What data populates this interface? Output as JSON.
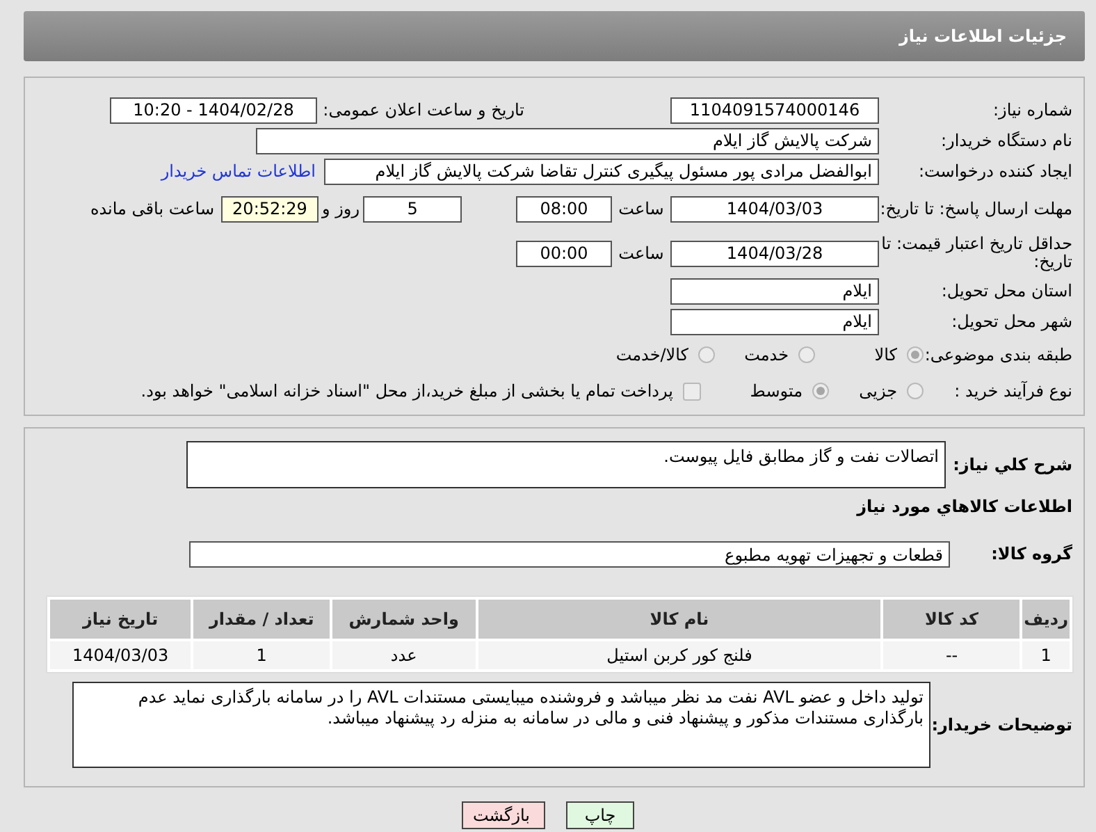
{
  "header": {
    "title": "جزئیات اطلاعات نیاز"
  },
  "details": {
    "need_number": {
      "label": "شماره نیاز:",
      "value": "1104091574000146"
    },
    "announce": {
      "label": "تاریخ و ساعت اعلان عمومی:",
      "value": "1404/02/28 - 10:20"
    },
    "buyer_org": {
      "label": "نام دستگاه خریدار:",
      "value": "شرکت پالایش گاز ایلام"
    },
    "requester": {
      "label": "ایجاد کننده درخواست:",
      "value": "ابوالفضل مرادی پور مسئول پیگیری کنترل تقاضا شرکت پالایش گاز ایلام",
      "link": "اطلاعات تماس خریدار"
    },
    "deadline": {
      "label": "مهلت ارسال پاسخ: تا تاریخ:",
      "date": "1404/03/03",
      "time_label": "ساعت",
      "time": "08:00",
      "days": "5",
      "days_label": "روز و",
      "remaining": "20:52:29",
      "remaining_label": "ساعت باقی مانده"
    },
    "price_validity": {
      "label": "حداقل تاریخ اعتبار قیمت: تا تاریخ:",
      "date": "1404/03/28",
      "time_label": "ساعت",
      "time": "00:00"
    },
    "province": {
      "label": "استان محل تحویل:",
      "value": "ایلام"
    },
    "city": {
      "label": "شهر محل تحویل:",
      "value": "ایلام"
    },
    "category": {
      "label": "طبقه بندی موضوعی:",
      "options": [
        {
          "label": "کالا",
          "selected": true
        },
        {
          "label": "خدمت",
          "selected": false
        },
        {
          "label": "کالا/خدمت",
          "selected": false
        }
      ]
    },
    "process": {
      "label": "نوع فرآیند خرید :",
      "options": [
        {
          "label": "جزیی",
          "selected": false
        },
        {
          "label": "متوسط",
          "selected": true
        }
      ],
      "payment": {
        "label": "پرداخت تمام یا بخشی از مبلغ خرید،از محل \"اسناد خزانه اسلامی\" خواهد بود.",
        "checked": false
      }
    }
  },
  "summary": {
    "label": "شرح کلي نیاز:",
    "value": "اتصالات نفت و گاز مطابق فایل پیوست."
  },
  "goods_title": "اطلاعات کالاهاي مورد نیاز",
  "goods_group": {
    "label": "گروه کالا:",
    "value": "قطعات و تجهیزات تهویه مطبوع"
  },
  "table": {
    "columns": [
      "ردیف",
      "کد کالا",
      "نام کالا",
      "واحد شمارش",
      "تعداد / مقدار",
      "تاریخ نیاز"
    ],
    "rows": [
      [
        "1",
        "--",
        "فلنج کور کربن استیل",
        "عدد",
        "1",
        "1404/03/03"
      ]
    ]
  },
  "notes": {
    "label": "توضیحات خریدار:",
    "value": "تولید داخل و عضو AVL نفت مد نظر میباشد و فروشنده میبایستی مستندات AVL را در سامانه بارگذاری نماید عدم بارگذاری مستندات مذکور و پیشنهاد فنی و مالی در سامانه به منزله رد پیشنهاد میباشد."
  },
  "buttons": [
    {
      "label": "چاپ",
      "kind": "print"
    },
    {
      "label": "بازگشت",
      "kind": "back"
    }
  ]
}
